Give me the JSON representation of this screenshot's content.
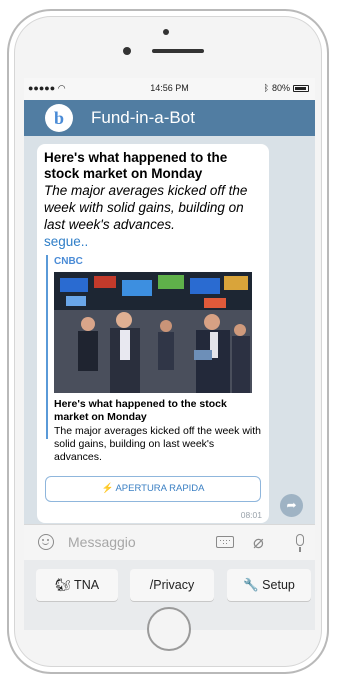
{
  "status_bar": {
    "signal": "●●●●● ",
    "time": "14:56 PM",
    "battery": "80%"
  },
  "header": {
    "bot_initial": "b",
    "bot_name": "Fund-in-a-Bot"
  },
  "message": {
    "title": "Here's what happened to the stock market on Monday",
    "description": "The major averages kicked off the week with solid gains, building on last week's advances.",
    "more_link": "segue..",
    "preview": {
      "source": "CNBC",
      "title": "Here's what happened to the stock market on Monday",
      "description": "The major averages kicked off the week with solid gains, building on last week's advances."
    },
    "action_button": "⚡ APERTURA RAPIDA",
    "time": "08:01"
  },
  "input": {
    "placeholder": "Messaggio"
  },
  "keyboard": {
    "buttons": [
      "🐿 TNA",
      "/Privacy",
      "🔧 Setup"
    ]
  },
  "colors": {
    "header": "#517da2",
    "link": "#2f7ec7"
  }
}
